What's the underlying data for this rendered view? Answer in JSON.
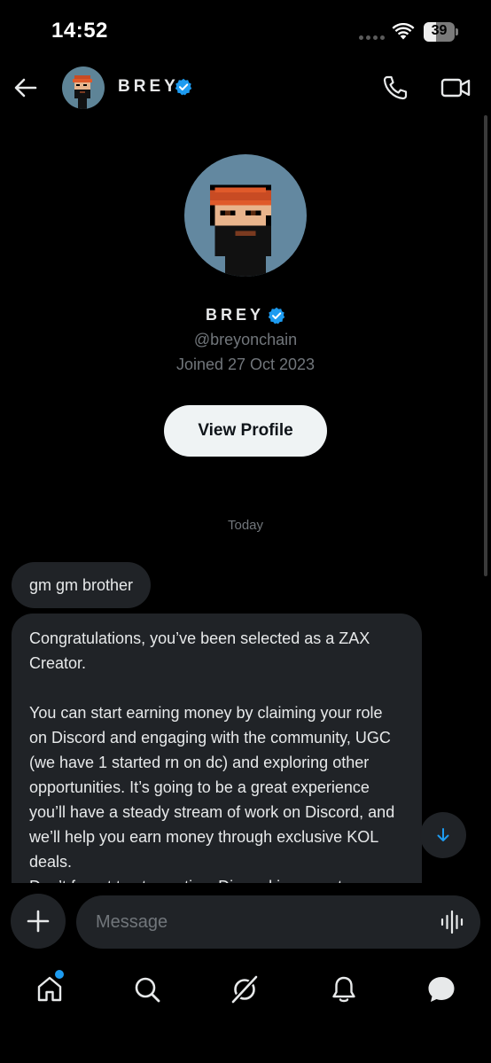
{
  "status_bar": {
    "time": "14:52",
    "battery_level": "39",
    "battery_fraction": 0.39
  },
  "header": {
    "name": "BREY",
    "verified": true
  },
  "profile": {
    "name": "BREY",
    "handle": "@breyonchain",
    "joined": "Joined 27 Oct 2023",
    "view_profile_label": "View Profile"
  },
  "conversation": {
    "date_separator": "Today",
    "messages": [
      {
        "text": "gm gm brother"
      },
      {
        "text": "Congratulations, you’ve been selected as a ZAX Creator.\n\nYou can start earning money by claiming your role on Discord and engaging with the community, UGC (we have 1 started rn on dc) and exploring other opportunities. It’s going to be a great experience you’ll have a steady stream of work on Discord, and we’ll help you earn money through exclusive KOL deals.\nDon’t forget to stay active. Discord is a great"
      }
    ]
  },
  "composer": {
    "placeholder": "Message"
  },
  "tab_bar": {
    "items": [
      "home-icon",
      "search-icon",
      "grok-icon",
      "bell-icon",
      "messages-icon"
    ],
    "home_has_badge": true
  },
  "colors": {
    "background": "#000000",
    "bubble": "#202327",
    "accent": "#1d9bf0",
    "muted_text": "#71767b",
    "avatar_bg": "#6388a0"
  }
}
